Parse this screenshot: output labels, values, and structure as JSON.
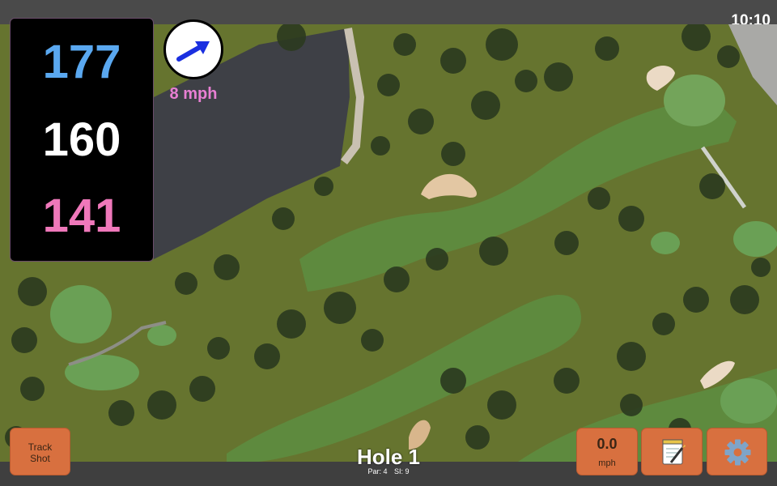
{
  "status": {
    "time": "10:10"
  },
  "distances": {
    "back": "177",
    "middle": "160",
    "front": "141"
  },
  "wind": {
    "speed_label": "8 mph",
    "icon": "wind-direction-arrow-icon"
  },
  "buttons": {
    "track_shot_line1": "Track",
    "track_shot_line2": "Shot",
    "speed_value": "0.0",
    "speed_unit": "mph",
    "notes_icon": "notepad-icon",
    "settings_icon": "gear-icon"
  },
  "hole": {
    "title": "Hole 1",
    "par": "Par: 4",
    "si": "SI: 9"
  },
  "colors": {
    "back_distance": "#5aa8f0",
    "middle_distance": "#ffffff",
    "front_distance": "#ef78ba",
    "wind_text": "#e87fd3",
    "button": "#d8703f"
  }
}
